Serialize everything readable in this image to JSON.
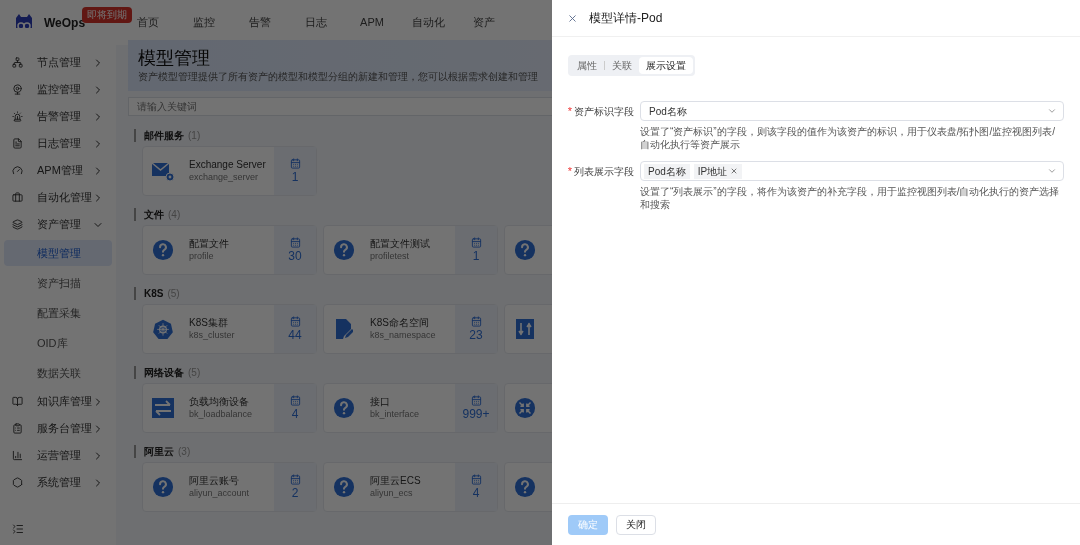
{
  "header": {
    "brand": "WeOps",
    "badge": "即将到期",
    "nav": [
      "首页",
      "监控",
      "告警",
      "日志",
      "APM",
      "自动化",
      "资产"
    ]
  },
  "sidebar": {
    "items": [
      {
        "label": "节点管理",
        "expanded": false
      },
      {
        "label": "监控管理",
        "expanded": false
      },
      {
        "label": "告警管理",
        "expanded": false
      },
      {
        "label": "日志管理",
        "expanded": false
      },
      {
        "label": "APM管理",
        "expanded": false
      },
      {
        "label": "自动化管理",
        "expanded": false
      },
      {
        "label": "资产管理",
        "expanded": true,
        "children": [
          {
            "label": "模型管理",
            "selected": true
          },
          {
            "label": "资产扫描",
            "selected": false
          },
          {
            "label": "配置采集",
            "selected": false
          },
          {
            "label": "OID库",
            "selected": false
          },
          {
            "label": "数据关联",
            "selected": false
          }
        ]
      },
      {
        "label": "知识库管理",
        "expanded": false
      },
      {
        "label": "服务台管理",
        "expanded": false
      },
      {
        "label": "运营管理",
        "expanded": false
      },
      {
        "label": "系统管理",
        "expanded": false
      }
    ]
  },
  "page": {
    "title": "模型管理",
    "description": "资产模型管理提供了所有资产的模型和模型分组的新建和管理，您可以根据需求创建和管理",
    "search_placeholder": "请输入关键词",
    "sections": [
      {
        "title": "邮件服务",
        "count": "(1)",
        "cards": [
          {
            "kind": "mail",
            "name": "Exchange Server",
            "id": "exchange_server",
            "count": "1"
          }
        ]
      },
      {
        "title": "文件",
        "count": "(4)",
        "cards": [
          {
            "kind": "question",
            "name": "配置文件",
            "id": "profile",
            "count": "30"
          },
          {
            "kind": "question",
            "name": "配置文件测试",
            "id": "profiletest",
            "count": "1"
          },
          {
            "kind": "question"
          }
        ]
      },
      {
        "title": "K8S",
        "count": "(5)",
        "cards": [
          {
            "kind": "wheel",
            "name": "K8S集群",
            "id": "k8s_cluster",
            "count": "44"
          },
          {
            "kind": "file",
            "name": "K8S命名空间",
            "id": "k8s_namespace",
            "count": "23"
          },
          {
            "kind": "sliders"
          }
        ]
      },
      {
        "title": "网络设备",
        "count": "(5)",
        "cards": [
          {
            "kind": "arrows",
            "name": "负载均衡设备",
            "id": "bk_loadbalance",
            "count": "4"
          },
          {
            "kind": "question",
            "name": "接口",
            "id": "bk_interface",
            "count": "999+"
          },
          {
            "kind": "shrink"
          }
        ]
      },
      {
        "title": "阿里云",
        "count": "(3)",
        "cards": [
          {
            "kind": "question",
            "name": "阿里云账号",
            "id": "aliyun_account",
            "count": "2"
          },
          {
            "kind": "question",
            "name": "阿里云ECS",
            "id": "aliyun_ecs",
            "count": "4"
          },
          {
            "kind": "question"
          }
        ]
      }
    ]
  },
  "drawer": {
    "title": "模型详情-Pod",
    "tabs": [
      {
        "label": "属性",
        "selected": false
      },
      {
        "label": "关联",
        "selected": false
      },
      {
        "label": "展示设置",
        "selected": true
      }
    ],
    "fields": [
      {
        "kind": "select",
        "required_mark": "*",
        "label": "资产标识字段",
        "value": "Pod名称",
        "hint": "设置了“资产标识”的字段，则该字段的值作为该资产的标识，用于仪表盘/拓扑图/监控视图列表/自动化执行等资产展示"
      },
      {
        "kind": "tags",
        "required_mark": "*",
        "label": "列表展示字段",
        "tags": [
          {
            "label": "Pod名称",
            "removable": false
          },
          {
            "label": "IP地址",
            "removable": true
          }
        ],
        "hint": "设置了“列表展示”的字段，将作为该资产的补充字段，用于监控视图列表/自动化执行的资产选择和搜索"
      }
    ],
    "buttons": [
      {
        "label": "确定",
        "kind": "primary",
        "disabled": true
      },
      {
        "label": "关闭",
        "kind": "default",
        "disabled": false
      }
    ]
  }
}
